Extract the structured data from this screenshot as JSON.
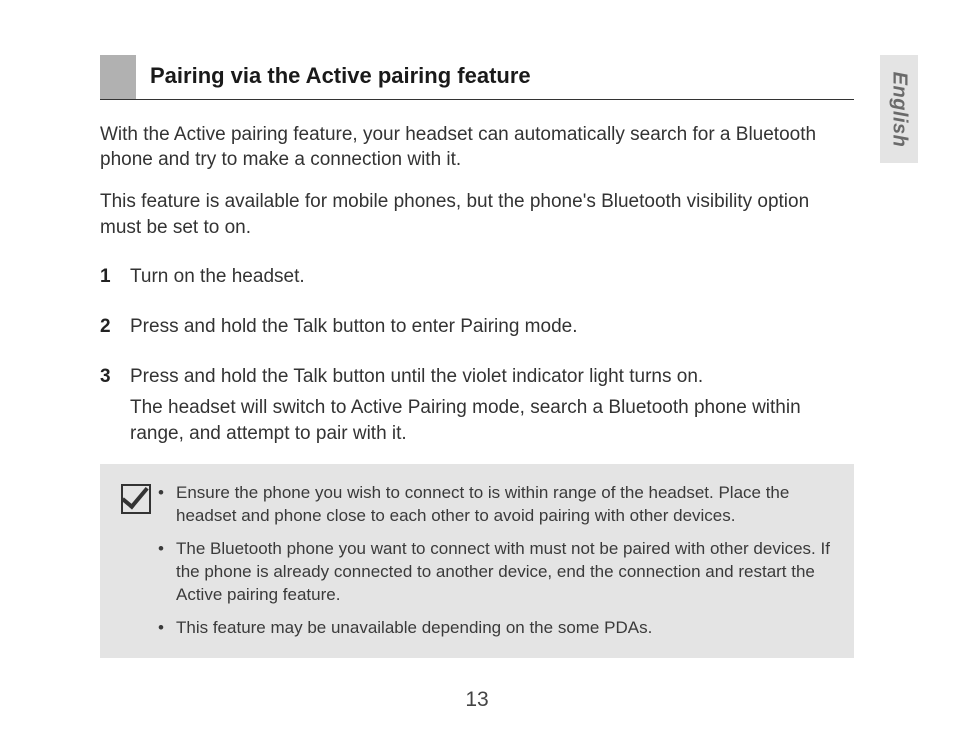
{
  "language_tab": "English",
  "heading": "Pairing via the Active pairing feature",
  "intro_paragraphs": [
    "With the Active pairing feature, your headset can automatically search for a Bluetooth phone and try to make a connection with it.",
    "This feature is available for mobile phones, but the phone's Bluetooth visibility option must be set to on."
  ],
  "steps": [
    {
      "num": "1",
      "primary": "Turn on the headset.",
      "secondary": ""
    },
    {
      "num": "2",
      "primary": "Press and hold the Talk button to enter Pairing mode.",
      "secondary": ""
    },
    {
      "num": "3",
      "primary": "Press and hold the Talk button until the violet indicator light turns on.",
      "secondary": "The headset will switch to Active Pairing mode, search a Bluetooth phone within range, and attempt to pair with it."
    }
  ],
  "notes": [
    "Ensure the phone you wish to connect to is within range of the headset. Place the headset and phone close to each other to avoid pairing with other devices.",
    "The Bluetooth phone you want to connect with must not be paired with other devices. If the phone is already connected to another device, end the connection and restart the Active pairing feature.",
    "This feature may be unavailable depending on the some PDAs."
  ],
  "page_number": "13"
}
